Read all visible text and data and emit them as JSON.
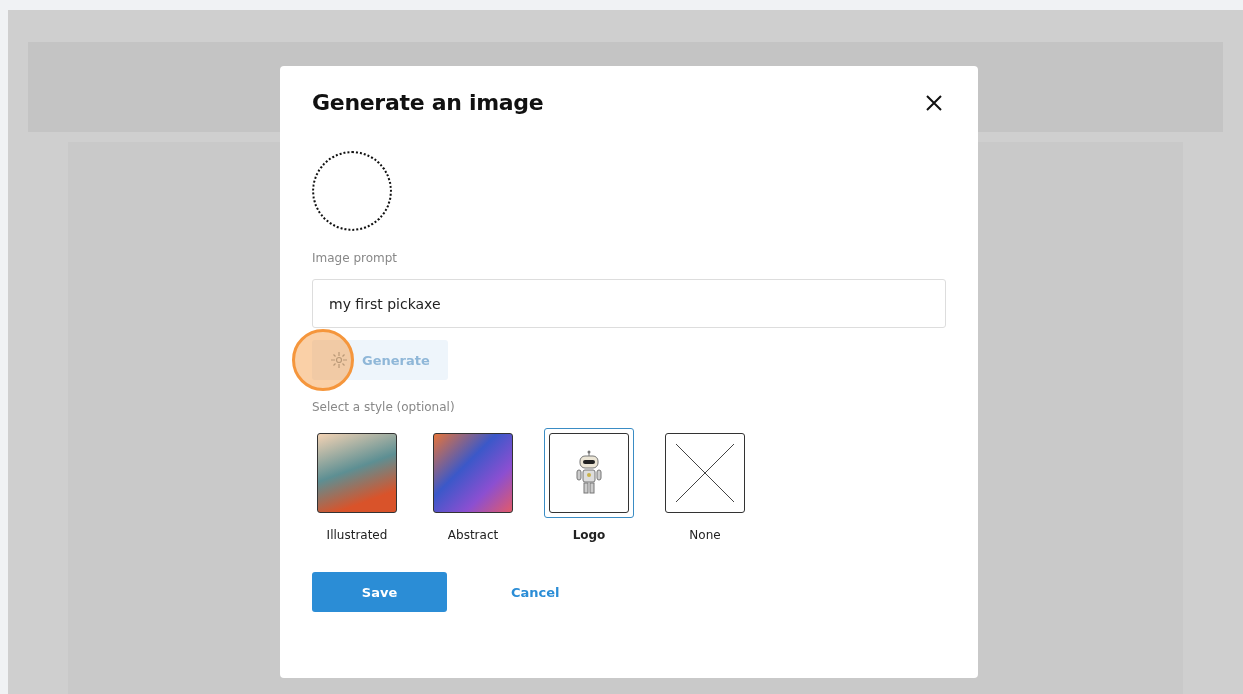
{
  "dialog": {
    "title": "Generate an image",
    "prompt_label": "Image prompt",
    "prompt_value": "my first pickaxe",
    "generate_button": {
      "label": "Generate",
      "disabled": true
    },
    "style_label": "Select a style (optional)",
    "styles": [
      {
        "label": "Illustrated",
        "kind": "illustrated",
        "selected": false
      },
      {
        "label": "Abstract",
        "kind": "abstract",
        "selected": false
      },
      {
        "label": "Logo",
        "kind": "logo",
        "selected": true
      },
      {
        "label": "None",
        "kind": "none",
        "selected": false
      }
    ],
    "save_button": "Save",
    "cancel_button": "Cancel"
  }
}
